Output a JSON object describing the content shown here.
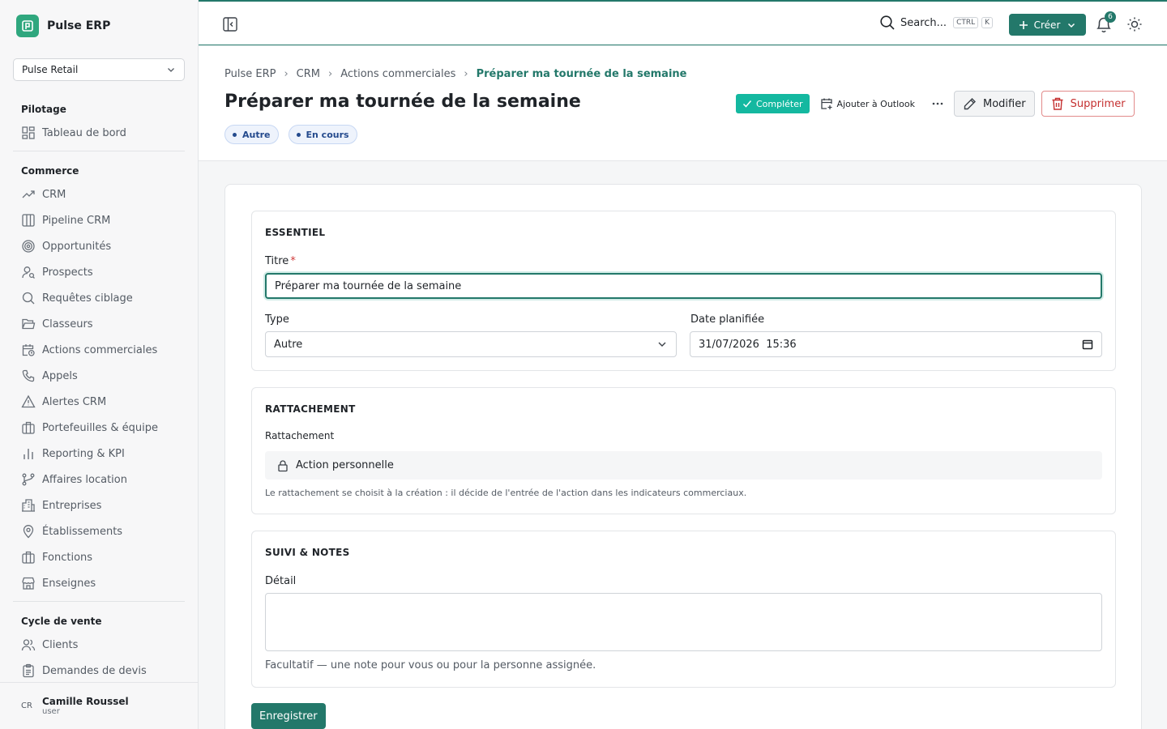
{
  "brand": {
    "name": "Pulse ERP"
  },
  "org": {
    "selected": "Pulse Retail"
  },
  "nav": {
    "sections": [
      {
        "title": "Pilotage",
        "items": [
          {
            "label": "Tableau de bord",
            "icon": "dashboard-icon"
          }
        ]
      },
      {
        "title": "Commerce",
        "items": [
          {
            "label": "CRM",
            "icon": "trend-icon"
          },
          {
            "label": "Pipeline CRM",
            "icon": "columns-icon"
          },
          {
            "label": "Opportunités",
            "icon": "target-icon"
          },
          {
            "label": "Prospects",
            "icon": "user-search-icon"
          },
          {
            "label": "Requêtes ciblage",
            "icon": "search-icon"
          },
          {
            "label": "Classeurs",
            "icon": "folder-icon"
          },
          {
            "label": "Actions commerciales",
            "icon": "calendar-clock-icon"
          },
          {
            "label": "Appels",
            "icon": "phone-icon"
          },
          {
            "label": "Alertes CRM",
            "icon": "alert-icon"
          },
          {
            "label": "Portefeuilles & équipe",
            "icon": "briefcase-icon"
          },
          {
            "label": "Reporting & KPI",
            "icon": "bar-chart-icon"
          },
          {
            "label": "Affaires location",
            "icon": "branch-icon"
          },
          {
            "label": "Entreprises",
            "icon": "building-icon"
          },
          {
            "label": "Établissements",
            "icon": "map-pin-icon"
          },
          {
            "label": "Fonctions",
            "icon": "briefcase-icon"
          },
          {
            "label": "Enseignes",
            "icon": "store-icon"
          }
        ]
      },
      {
        "title": "Cycle de vente",
        "items": [
          {
            "label": "Clients",
            "icon": "users-icon"
          },
          {
            "label": "Demandes de devis",
            "icon": "clipboard-icon"
          }
        ]
      }
    ]
  },
  "user": {
    "initials": "CR",
    "name": "Camille Roussel",
    "role": "user"
  },
  "topbar": {
    "search_label": "Search...",
    "shortcut_ctrl": "CTRL",
    "shortcut_key": "K",
    "create_label": "Créer",
    "notifications_count": "6"
  },
  "breadcrumb": [
    "Pulse ERP",
    "CRM",
    "Actions commerciales",
    "Préparer ma tournée de la semaine"
  ],
  "page": {
    "title": "Préparer ma tournée de la semaine",
    "badges": [
      "Autre",
      "En cours"
    ],
    "actions": {
      "complete": "Compléter",
      "outlook": "Ajouter à Outlook",
      "modify": "Modifier",
      "delete": "Supprimer"
    }
  },
  "form": {
    "essentiel": {
      "title": "ESSENTIEL",
      "titre_label": "Titre",
      "required_mark": "*",
      "titre_value": "Préparer ma tournée de la semaine",
      "type_label": "Type",
      "type_value": "Autre",
      "date_label": "Date planifiée",
      "date_value": "31/07/2026  15:36"
    },
    "rattachement": {
      "title": "RATTACHEMENT",
      "label": "Rattachement",
      "value": "Action personnelle",
      "help": "Le rattachement se choisit à la création : il décide de l'entrée de l'action dans les indicateurs commerciaux."
    },
    "suivi": {
      "title": "SUIVI & NOTES",
      "detail_label": "Détail",
      "detail_value": "",
      "help": "Facultatif — une note pour vous ou pour la personne assignée."
    },
    "save_label": "Enregistrer"
  },
  "colors": {
    "accent": "#23786a",
    "complete": "#14b8a0",
    "danger": "#c53030",
    "badge": "#244a8d"
  }
}
